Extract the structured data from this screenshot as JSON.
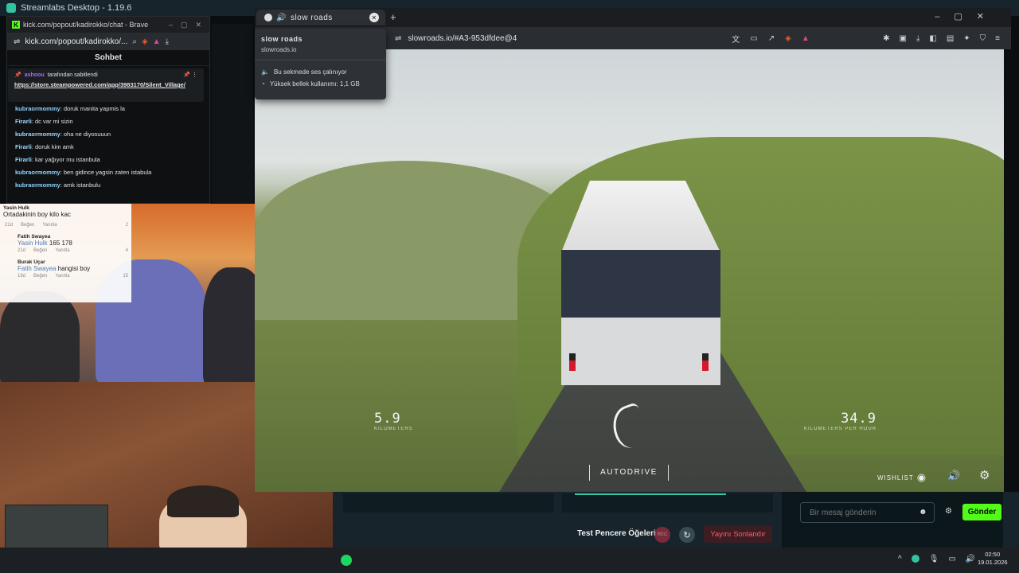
{
  "app": {
    "title": "Streamlabs Desktop - 1.19.6"
  },
  "chat_browser": {
    "tab_title": "kick.com/popout/kadirokko/chat - Brave",
    "address": "kick.com/popout/kadirokko/...",
    "header": "Sohbet",
    "pinned": {
      "by_user": "ashoou",
      "by_text": "tarafından sabitlendi",
      "url": "https://store.steampowered.com/app/3983170/Silent_Village/"
    },
    "messages": [
      {
        "user": "kubraormommy",
        "text": "doruk manita yapmis la"
      },
      {
        "user": "Firarli",
        "text": "dc var mi sizin"
      },
      {
        "user": "kubraormommy",
        "text": "oha ne diyosuuun"
      },
      {
        "user": "Firarli",
        "text": "doruk kim amk"
      },
      {
        "user": "Firarli",
        "text": "kar yağıyor mu istanbula"
      },
      {
        "user": "kubraormommy",
        "text": "ben gidince yagsin zaten istabula"
      },
      {
        "user": "kubraormommy",
        "text": "amk istanbulu"
      }
    ]
  },
  "comments": {
    "top_user": "Yasin Hulk",
    "top_text": "Ortadakinin boy kilo kac",
    "top_meta": [
      "21d",
      "Beğen",
      "Yanıtla"
    ],
    "top_likes": "2",
    "items": [
      {
        "name": "Fatih Swayea",
        "mention": "Yasin Hulk",
        "text": "165 178",
        "meta": [
          "21d",
          "Beğen",
          "Yanıtla"
        ],
        "likes": "4"
      },
      {
        "name": "Burak Uçar",
        "mention": "Fatih Swayea",
        "text": "hangisi boy",
        "meta": [
          "19d",
          "Beğen",
          "Yanıtla"
        ],
        "likes": "15"
      }
    ]
  },
  "browser": {
    "tab_label": "slow roads",
    "url": "slowroads.io/#A3-953dfdee@4",
    "popup": {
      "title": "slow roads",
      "domain": "slowroads.io",
      "audio_line": "Bu sekmede ses çalınıyor",
      "memory_line": "Yüksek bellek kullanımı: 1,1 GB"
    }
  },
  "game": {
    "distance": "5.9",
    "distance_label": "KILOMETERS",
    "speed": "34.9",
    "speed_label": "KILOMETERS PER HOUR",
    "autodrive": "AUTODRIVE",
    "wishlist": "WISHLIST"
  },
  "streamlabs": {
    "test_label": "Test Pencere Öğeleri",
    "rec_label": "REC",
    "end_stream": "Yayını Sonlandır",
    "chat_placeholder": "Bir mesaj gönderin",
    "send": "Gönder"
  },
  "taskbar": {
    "time": "02:50",
    "date": "19.01.2026"
  },
  "colors": {
    "kick_green": "#53fc18",
    "end_red": "#ff5c6e",
    "spotify": "#1ed760"
  }
}
